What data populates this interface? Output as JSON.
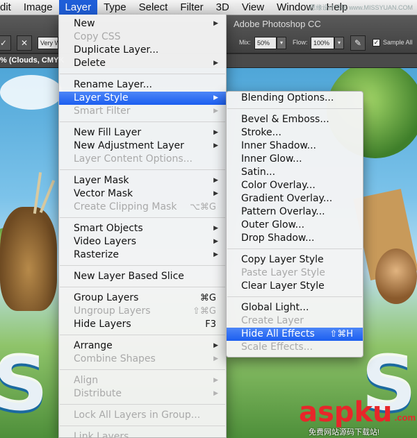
{
  "menubar": {
    "items": [
      {
        "label": "dit"
      },
      {
        "label": "Image"
      },
      {
        "label": "Layer",
        "active": true
      },
      {
        "label": "Type"
      },
      {
        "label": "Select"
      },
      {
        "label": "Filter"
      },
      {
        "label": "3D"
      },
      {
        "label": "View"
      },
      {
        "label": "Window"
      },
      {
        "label": "Help"
      }
    ],
    "watermark": "思缘设计论坛 www.MISSYUAN.COM"
  },
  "options_bar": {
    "app_title": "Adobe Photoshop CC",
    "brush_preset": "Very W",
    "mix_label": "Mix:",
    "mix_value": "50%",
    "flow_label": "Flow:",
    "flow_value": "100%",
    "sample_all_label": "Sample All"
  },
  "document_tab": {
    "title": "% (Clouds, CMYK"
  },
  "layer_menu": {
    "sections": [
      [
        {
          "label": "New",
          "submenu": true
        },
        {
          "label": "Copy CSS",
          "disabled": true
        },
        {
          "label": "Duplicate Layer..."
        },
        {
          "label": "Delete",
          "submenu": true
        }
      ],
      [
        {
          "label": "Rename Layer..."
        },
        {
          "label": "Layer Style",
          "submenu": true,
          "active": true
        },
        {
          "label": "Smart Filter",
          "submenu": true,
          "disabled": true
        }
      ],
      [
        {
          "label": "New Fill Layer",
          "submenu": true
        },
        {
          "label": "New Adjustment Layer",
          "submenu": true
        },
        {
          "label": "Layer Content Options...",
          "disabled": true
        }
      ],
      [
        {
          "label": "Layer Mask",
          "submenu": true
        },
        {
          "label": "Vector Mask",
          "submenu": true
        },
        {
          "label": "Create Clipping Mask",
          "shortcut": "⌥⌘G",
          "disabled": true
        }
      ],
      [
        {
          "label": "Smart Objects",
          "submenu": true
        },
        {
          "label": "Video Layers",
          "submenu": true
        },
        {
          "label": "Rasterize",
          "submenu": true
        }
      ],
      [
        {
          "label": "New Layer Based Slice"
        }
      ],
      [
        {
          "label": "Group Layers",
          "shortcut": "⌘G"
        },
        {
          "label": "Ungroup Layers",
          "shortcut": "⇧⌘G",
          "disabled": true
        },
        {
          "label": "Hide Layers",
          "shortcut": "F3"
        }
      ],
      [
        {
          "label": "Arrange",
          "submenu": true
        },
        {
          "label": "Combine Shapes",
          "submenu": true,
          "disabled": true
        }
      ],
      [
        {
          "label": "Align",
          "submenu": true,
          "disabled": true
        },
        {
          "label": "Distribute",
          "submenu": true,
          "disabled": true
        }
      ],
      [
        {
          "label": "Lock All Layers in Group...",
          "disabled": true
        }
      ],
      [
        {
          "label": "Link Layers",
          "disabled": true
        }
      ]
    ]
  },
  "layer_style_submenu": {
    "sections": [
      [
        {
          "label": "Blending Options..."
        }
      ],
      [
        {
          "label": "Bevel & Emboss..."
        },
        {
          "label": "Stroke..."
        },
        {
          "label": "Inner Shadow..."
        },
        {
          "label": "Inner Glow..."
        },
        {
          "label": "Satin..."
        },
        {
          "label": "Color Overlay..."
        },
        {
          "label": "Gradient Overlay..."
        },
        {
          "label": "Pattern Overlay..."
        },
        {
          "label": "Outer Glow..."
        },
        {
          "label": "Drop Shadow..."
        }
      ],
      [
        {
          "label": "Copy Layer Style"
        },
        {
          "label": "Paste Layer Style",
          "disabled": true
        },
        {
          "label": "Clear Layer Style"
        }
      ],
      [
        {
          "label": "Global Light..."
        },
        {
          "label": "Create Layer",
          "disabled": true
        },
        {
          "label": "Hide All Effects",
          "shortcut": "⇧⌘H",
          "active": true
        },
        {
          "label": "Scale Effects...",
          "disabled": true
        }
      ]
    ]
  },
  "watermark": {
    "brand_a": "asp",
    "brand_b": "ku",
    "dotcom": ".com",
    "tagline": "免费网站源码下载站!"
  },
  "colors": {
    "highlight": "#1b5ef0",
    "brand_red": "#e8262a"
  }
}
